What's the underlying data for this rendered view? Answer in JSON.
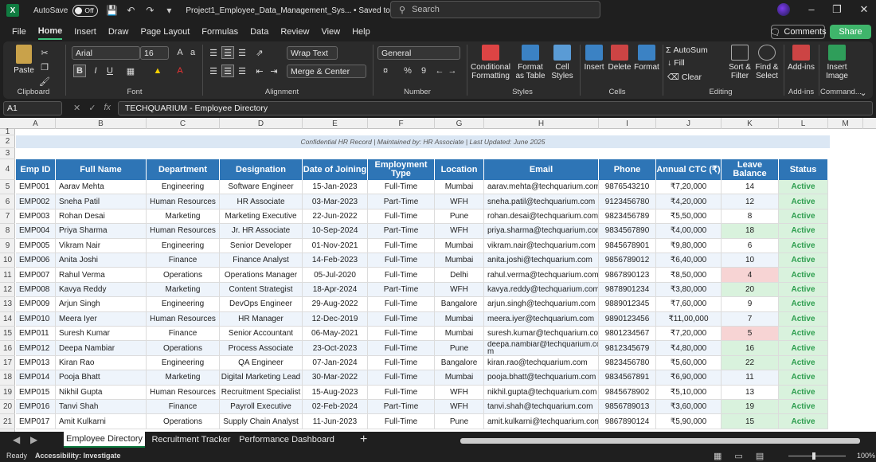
{
  "titlebar": {
    "app_icon": "excel-logo",
    "autosave_label": "AutoSave",
    "autosave_state": "Off",
    "doc_title": "Project1_Employee_Data_Management_Sys...  •  Saved to this PC",
    "search_placeholder": "Search"
  },
  "menu": {
    "items": [
      "File",
      "Home",
      "Insert",
      "Draw",
      "Page Layout",
      "Formulas",
      "Data",
      "Review",
      "View",
      "Help"
    ],
    "active": "Home",
    "comments": "Comments",
    "share": "Share"
  },
  "ribbon": {
    "clipboard": {
      "paste": "Paste",
      "label": "Clipboard"
    },
    "font": {
      "name": "Arial",
      "size": "16",
      "bold": "B",
      "italic": "I",
      "underline": "U",
      "label": "Font"
    },
    "alignment": {
      "wrap_text": "Wrap Text",
      "merge_center": "Merge & Center",
      "label": "Alignment"
    },
    "number": {
      "format": "General",
      "percent": "%",
      "comma": "9",
      "label": "Number"
    },
    "styles": {
      "conditional": "Conditional Formatting",
      "format_table": "Format as Table",
      "cell_styles": "Cell Styles",
      "label": "Styles"
    },
    "cells": {
      "insert": "Insert",
      "delete": "Delete",
      "format": "Format",
      "label": "Cells"
    },
    "editing": {
      "autosum": "AutoSum",
      "fill": "Fill",
      "clear": "Clear",
      "sort_filter": "Sort & Filter",
      "find_select": "Find & Select",
      "label": "Editing"
    },
    "addins": {
      "addins": "Add-ins",
      "label": "Add-ins"
    },
    "commands": {
      "insert_image": "Insert Image",
      "label": "Command..."
    }
  },
  "formula_bar": {
    "name_box": "A1",
    "formula": "TECHQUARIUM - Employee Directory"
  },
  "sheet": {
    "columns": [
      "A",
      "B",
      "C",
      "D",
      "E",
      "F",
      "G",
      "H",
      "I",
      "J",
      "K",
      "L",
      "M"
    ],
    "row_numbers": [
      "1",
      "2",
      "3",
      "4",
      "5",
      "6",
      "7",
      "8",
      "9",
      "10",
      "11",
      "12",
      "13",
      "14",
      "15",
      "16",
      "17",
      "18",
      "19",
      "20",
      "21"
    ],
    "confidential_note": "Confidential HR Record  |  Maintained by: HR Associate  |  Last Updated: June 2025",
    "headers": [
      "Emp ID",
      "Full Name",
      "Department",
      "Designation",
      "Date of Joining",
      "Employment Type",
      "Location",
      "Email",
      "Phone",
      "Annual CTC (₹)",
      "Leave Balance",
      "Status"
    ],
    "rows": [
      [
        "EMP001",
        "Aarav Mehta",
        "Engineering",
        "Software Engineer",
        "15-Jan-2023",
        "Full-Time",
        "Mumbai",
        "aarav.mehta@techquarium.com",
        "9876543210",
        "₹7,20,000",
        "14",
        "Active"
      ],
      [
        "EMP002",
        "Sneha Patil",
        "Human Resources",
        "HR Associate",
        "03-Mar-2023",
        "Part-Time",
        "WFH",
        "sneha.patil@techquarium.com",
        "9123456780",
        "₹4,20,000",
        "12",
        "Active"
      ],
      [
        "EMP003",
        "Rohan Desai",
        "Marketing",
        "Marketing Executive",
        "22-Jun-2022",
        "Full-Time",
        "Pune",
        "rohan.desai@techquarium.com",
        "9823456789",
        "₹5,50,000",
        "8",
        "Active"
      ],
      [
        "EMP004",
        "Priya Sharma",
        "Human Resources",
        "Jr. HR Associate",
        "10-Sep-2024",
        "Part-Time",
        "WFH",
        "priya.sharma@techquarium.com",
        "9834567890",
        "₹4,00,000",
        "18",
        "Active"
      ],
      [
        "EMP005",
        "Vikram Nair",
        "Engineering",
        "Senior Developer",
        "01-Nov-2021",
        "Full-Time",
        "Mumbai",
        "vikram.nair@techquarium.com",
        "9845678901",
        "₹9,80,000",
        "6",
        "Active"
      ],
      [
        "EMP006",
        "Anita Joshi",
        "Finance",
        "Finance Analyst",
        "14-Feb-2023",
        "Full-Time",
        "Mumbai",
        "anita.joshi@techquarium.com",
        "9856789012",
        "₹6,40,000",
        "10",
        "Active"
      ],
      [
        "EMP007",
        "Rahul Verma",
        "Operations",
        "Operations Manager",
        "05-Jul-2020",
        "Full-Time",
        "Delhi",
        "rahul.verma@techquarium.com",
        "9867890123",
        "₹8,50,000",
        "4",
        "Active"
      ],
      [
        "EMP008",
        "Kavya Reddy",
        "Marketing",
        "Content Strategist",
        "18-Apr-2024",
        "Part-Time",
        "WFH",
        "kavya.reddy@techquarium.com",
        "9878901234",
        "₹3,80,000",
        "20",
        "Active"
      ],
      [
        "EMP009",
        "Arjun Singh",
        "Engineering",
        "DevOps Engineer",
        "29-Aug-2022",
        "Full-Time",
        "Bangalore",
        "arjun.singh@techquarium.com",
        "9889012345",
        "₹7,60,000",
        "9",
        "Active"
      ],
      [
        "EMP010",
        "Meera Iyer",
        "Human Resources",
        "HR Manager",
        "12-Dec-2019",
        "Full-Time",
        "Mumbai",
        "meera.iyer@techquarium.com",
        "9890123456",
        "₹11,00,000",
        "7",
        "Active"
      ],
      [
        "EMP011",
        "Suresh Kumar",
        "Finance",
        "Senior Accountant",
        "06-May-2021",
        "Full-Time",
        "Mumbai",
        "suresh.kumar@techquarium.com",
        "9801234567",
        "₹7,20,000",
        "5",
        "Active"
      ],
      [
        "EMP012",
        "Deepa Nambiar",
        "Operations",
        "Process Associate",
        "23-Oct-2023",
        "Full-Time",
        "Pune",
        "deepa.nambiar@techquarium.co m",
        "9812345679",
        "₹4,80,000",
        "16",
        "Active"
      ],
      [
        "EMP013",
        "Kiran Rao",
        "Engineering",
        "QA Engineer",
        "07-Jan-2024",
        "Full-Time",
        "Bangalore",
        "kiran.rao@techquarium.com",
        "9823456780",
        "₹5,60,000",
        "22",
        "Active"
      ],
      [
        "EMP014",
        "Pooja Bhatt",
        "Marketing",
        "Digital Marketing Lead",
        "30-Mar-2022",
        "Full-Time",
        "Mumbai",
        "pooja.bhatt@techquarium.com",
        "9834567891",
        "₹6,90,000",
        "11",
        "Active"
      ],
      [
        "EMP015",
        "Nikhil Gupta",
        "Human Resources",
        "Recruitment Specialist",
        "15-Aug-2023",
        "Full-Time",
        "WFH",
        "nikhil.gupta@techquarium.com",
        "9845678902",
        "₹5,10,000",
        "13",
        "Active"
      ],
      [
        "EMP016",
        "Tanvi Shah",
        "Finance",
        "Payroll Executive",
        "02-Feb-2024",
        "Part-Time",
        "WFH",
        "tanvi.shah@techquarium.com",
        "9856789013",
        "₹3,60,000",
        "19",
        "Active"
      ],
      [
        "EMP017",
        "Amit Kulkarni",
        "Operations",
        "Supply Chain Analyst",
        "11-Jun-2023",
        "Full-Time",
        "Pune",
        "amit.kulkarni@techquarium.com",
        "9867890124",
        "₹5,90,000",
        "15",
        "Active"
      ]
    ],
    "leave_highlight": [
      "white",
      "white",
      "white",
      "green",
      "white",
      "white",
      "red",
      "green",
      "white",
      "white",
      "red",
      "green",
      "green",
      "white",
      "white",
      "green",
      "green"
    ]
  },
  "tabs": {
    "items": [
      "Employee Directory",
      "Recruitment Tracker",
      "Performance Dashboard"
    ],
    "active": "Employee Directory",
    "add": "+"
  },
  "status": {
    "ready": "Ready",
    "accessibility": "Accessibility: Investigate",
    "zoom": "100%"
  },
  "colors": {
    "header_blue": "#2e75b6",
    "excel_green": "#107c41",
    "active_green_bg": "#d9f2dd",
    "low_leave_red_bg": "#f7d4d4"
  }
}
